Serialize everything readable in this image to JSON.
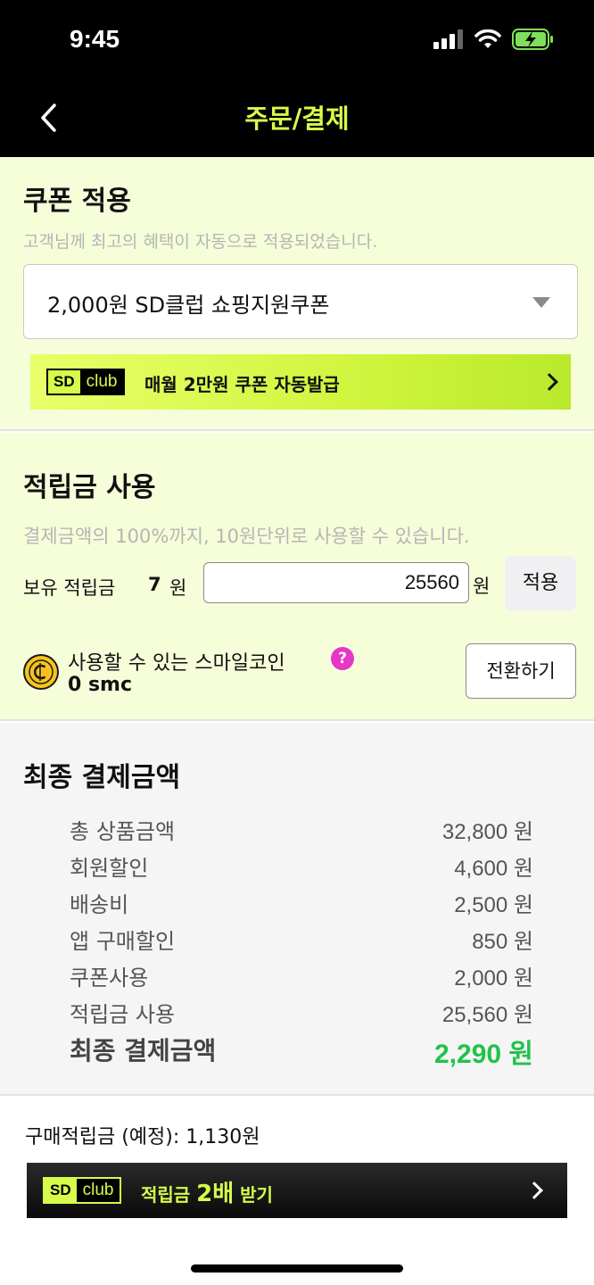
{
  "status_bar": {
    "time": "9:45"
  },
  "nav": {
    "title": "주문/결제"
  },
  "coupon": {
    "title": "쿠폰 적용",
    "subtitle": "고객님께 최고의 혜택이 자동으로 적용되었습니다.",
    "selected": "2,000원 SD클럽 쇼핑지원쿠폰",
    "banner": {
      "logo_sd": "SD",
      "logo_club": "club",
      "text": "매월 2만원 쿠폰 자동발급"
    }
  },
  "points": {
    "title": "적립금 사용",
    "subtitle": "결제금액의 100%까지, 10원단위로 사용할 수 있습니다.",
    "held_label": "보유 적립금",
    "held_value": "7",
    "held_unit": "원",
    "input_value": "25560",
    "input_unit": "원",
    "apply_label": "적용",
    "coin_label": "사용할 수 있는 스마일코인",
    "coin_help": "?",
    "coin_value": "0 smc",
    "convert_label": "전환하기"
  },
  "final": {
    "title": "최종 결제금액",
    "rows": [
      {
        "label": "총 상품금액",
        "value": "32,800 원"
      },
      {
        "label": "회원할인",
        "value": "4,600 원"
      },
      {
        "label": "배송비",
        "value": "2,500 원"
      },
      {
        "label": "앱 구매할인",
        "value": "850 원"
      },
      {
        "label": "쿠폰사용",
        "value": "2,000 원"
      },
      {
        "label": "적립금 사용",
        "value": "25,560 원"
      }
    ],
    "total": {
      "label": "최종 결제금액",
      "value": "2,290 원"
    }
  },
  "purchase_points": "구매적립금 (예정): 1,130원",
  "double_banner": {
    "logo_sd": "SD",
    "logo_club": "club",
    "text_pre": "적립금 ",
    "text_big": "2배",
    "text_post": " 받기"
  },
  "colors": {
    "accent": "#d6fb4a",
    "section_bg": "#f5fed9",
    "total": "#21c24a",
    "help": "#e637c5",
    "coin": "#f6c419"
  }
}
